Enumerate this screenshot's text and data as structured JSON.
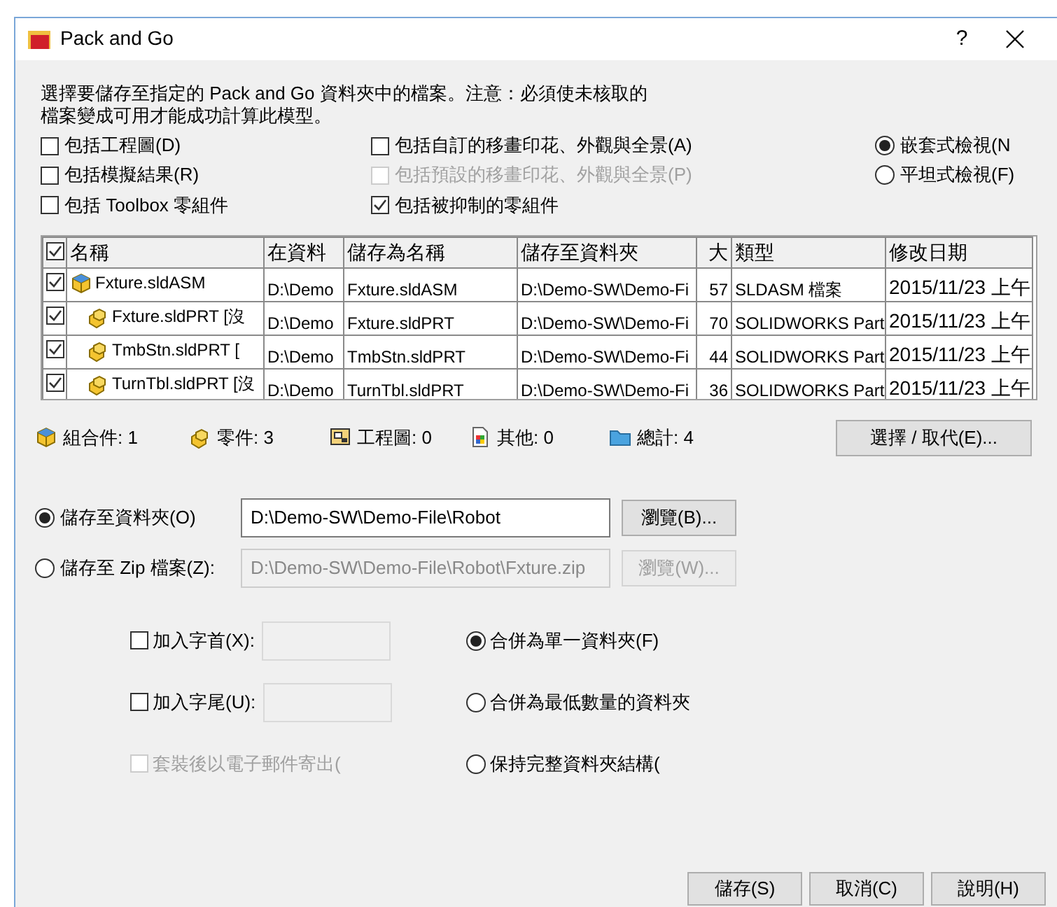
{
  "window": {
    "title": "Pack and Go",
    "help": "?"
  },
  "description": [
    "選擇要儲存至指定的 Pack and Go 資料夾中的檔案。注意：必須使未核取的",
    "檔案變成可用才能成功計算此模型。"
  ],
  "options": [
    {
      "label": "包括工程圖(D)",
      "checked": false,
      "disabled": false
    },
    {
      "label": "包括自訂的移畫印花、外觀與全景(A)",
      "checked": false,
      "disabled": false
    },
    {
      "label": "包括模擬結果(R)",
      "checked": false,
      "disabled": false
    },
    {
      "label": "包括預設的移畫印花、外觀與全景(P)",
      "checked": false,
      "disabled": true
    },
    {
      "label": "包括 Toolbox 零組件",
      "checked": false,
      "disabled": false
    },
    {
      "label": "包括被抑制的零組件",
      "checked": true,
      "disabled": false
    }
  ],
  "view_modes": [
    {
      "label": "嵌套式檢視(N",
      "selected": true
    },
    {
      "label": "平坦式檢視(F)",
      "selected": false
    }
  ],
  "table": {
    "header_checked": true,
    "columns": [
      "名稱",
      "在資料",
      "儲存為名稱",
      "儲存至資料夾",
      "大",
      "類型",
      "修改日期"
    ],
    "rows": [
      {
        "checked": true,
        "kind": "assembly",
        "cells": [
          "Fxture.sldASM",
          "D:\\Demo",
          "Fxture.sldASM",
          "D:\\Demo-SW\\Demo-Fi",
          "57",
          "SLDASM 檔案",
          "2015/11/23 上午"
        ],
        "children": [
          {
            "checked": true,
            "kind": "part",
            "cells": [
              "Fxture.sldPRT [沒",
              "D:\\Demo",
              "Fxture.sldPRT",
              "D:\\Demo-SW\\Demo-Fi",
              "70",
              "SOLIDWORKS Part",
              "2015/11/23 上午"
            ]
          },
          {
            "checked": true,
            "kind": "part",
            "cells": [
              "TmbStn.sldPRT [",
              "D:\\Demo",
              "TmbStn.sldPRT",
              "D:\\Demo-SW\\Demo-Fi",
              "44",
              "SOLIDWORKS Part",
              "2015/11/23 上午"
            ]
          },
          {
            "checked": true,
            "kind": "part",
            "cells": [
              "TurnTbl.sldPRT [沒",
              "D:\\Demo",
              "TurnTbl.sldPRT",
              "D:\\Demo-SW\\Demo-Fi",
              "36",
              "SOLIDWORKS Part",
              "2015/11/23 上午"
            ]
          }
        ]
      }
    ]
  },
  "summary": [
    {
      "kind": "assembly",
      "label": "組合件: 1"
    },
    {
      "kind": "part",
      "label": "零件: 3"
    },
    {
      "kind": "drawing",
      "label": "工程圖: 0"
    },
    {
      "kind": "other",
      "label": "其他: 0"
    },
    {
      "kind": "folder",
      "label": "總計: 4"
    }
  ],
  "select_replace_button": "選擇 / 取代(E)...",
  "save_targets": [
    {
      "label": "儲存至資料夾(O)",
      "selected": true,
      "path": "D:\\Demo-SW\\Demo-File\\Robot",
      "browse": "瀏覽(B)...",
      "disabled": false
    },
    {
      "label": "儲存至 Zip 檔案(Z):",
      "selected": false,
      "path": "D:\\Demo-SW\\Demo-File\\Robot\\Fxture.zip",
      "browse": "瀏覽(W)...",
      "disabled": true
    }
  ],
  "affixes": [
    {
      "kind": "field",
      "label": "加入字首(X):",
      "checked": false,
      "disabled": false
    },
    {
      "kind": "field",
      "label": "加入字尾(U):",
      "checked": false,
      "disabled": false
    },
    {
      "kind": "plain",
      "label": "套裝後以電子郵件寄出(",
      "checked": false,
      "disabled": true
    }
  ],
  "folder_modes": [
    {
      "label": "合併為單一資料夾(F)",
      "selected": true
    },
    {
      "label": "合併為最低數量的資料夾",
      "selected": false
    },
    {
      "label": "保持完整資料夾結構(",
      "selected": false
    }
  ],
  "buttons": [
    "儲存(S)",
    "取消(C)",
    "說明(H)"
  ]
}
